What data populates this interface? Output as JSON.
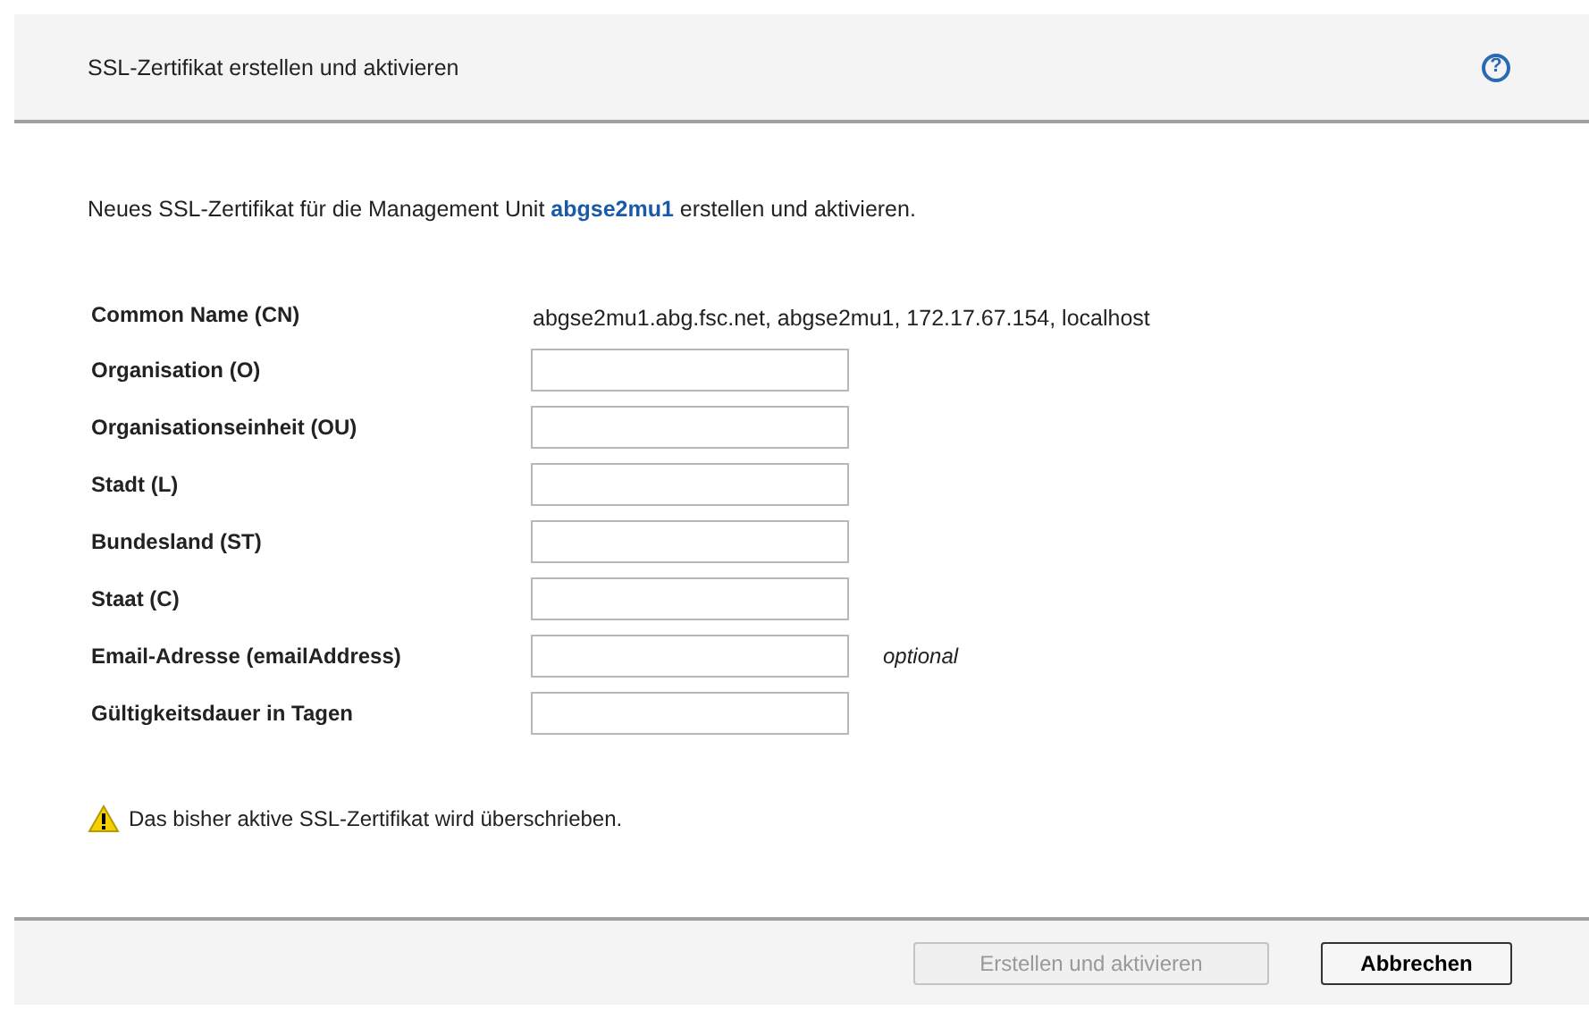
{
  "header": {
    "title": "SSL-Zertifikat erstellen und aktivieren",
    "help": "?"
  },
  "intro": {
    "before": "Neues SSL-Zertifikat für die Management Unit ",
    "link": "abgse2mu1",
    "after": " erstellen und aktivieren."
  },
  "fields": [
    {
      "kind": "text",
      "label": "Common Name (CN)",
      "value": "abgse2mu1.abg.fsc.net, abgse2mu1, 172.17.67.154, localhost"
    },
    {
      "kind": "input",
      "label": "Organisation (O)"
    },
    {
      "kind": "input",
      "label": "Organisationseinheit (OU)"
    },
    {
      "kind": "input",
      "label": "Stadt (L)"
    },
    {
      "kind": "input",
      "label": "Bundesland (ST)"
    },
    {
      "kind": "input",
      "label": "Staat (C)"
    },
    {
      "kind": "input",
      "label": "Email-Adresse (emailAddress)",
      "note": "optional"
    },
    {
      "kind": "input",
      "label": "Gültigkeitsdauer in Tagen"
    }
  ],
  "warning": "Das bisher aktive SSL-Zertifikat wird überschrieben.",
  "buttons": [
    {
      "label": "Erstellen und aktivieren",
      "disabled": true
    },
    {
      "label": "Abbrechen",
      "disabled": false
    }
  ]
}
